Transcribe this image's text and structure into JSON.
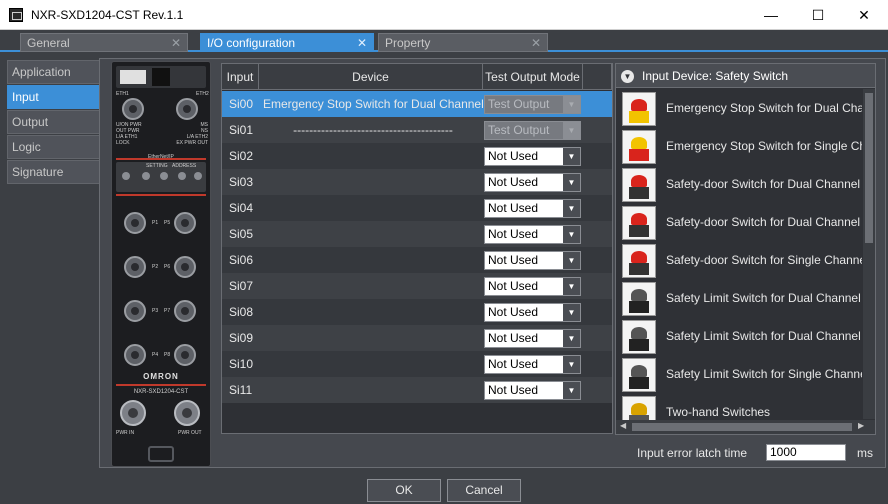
{
  "window": {
    "title": "NXR-SXD1204-CST Rev.1.1",
    "minimize_glyph": "—",
    "maximize_glyph": "☐",
    "close_glyph": "✕"
  },
  "tabs": [
    {
      "label": "General",
      "close": "✕"
    },
    {
      "label": "I/O configuration",
      "close": "✕"
    },
    {
      "label": "Property",
      "close": "✕"
    }
  ],
  "sidetabs": [
    "Application",
    "Input",
    "Output",
    "Logic",
    "Signature"
  ],
  "table": {
    "headers": [
      "Input",
      "Device",
      "Test Output Mode"
    ],
    "rows": [
      {
        "input": "Si00",
        "device": "Emergency Stop Switch for Dual Channel",
        "mode": "Test Output"
      },
      {
        "input": "Si01",
        "device": "----------------------------------------",
        "mode": "Test Output"
      },
      {
        "input": "Si02",
        "device": "",
        "mode": "Not Used"
      },
      {
        "input": "Si03",
        "device": "",
        "mode": "Not Used"
      },
      {
        "input": "Si04",
        "device": "",
        "mode": "Not Used"
      },
      {
        "input": "Si05",
        "device": "",
        "mode": "Not Used"
      },
      {
        "input": "Si06",
        "device": "",
        "mode": "Not Used"
      },
      {
        "input": "Si07",
        "device": "",
        "mode": "Not Used"
      },
      {
        "input": "Si08",
        "device": "",
        "mode": "Not Used"
      },
      {
        "input": "Si09",
        "device": "",
        "mode": "Not Used"
      },
      {
        "input": "Si10",
        "device": "",
        "mode": "Not Used"
      },
      {
        "input": "Si11",
        "device": "",
        "mode": "Not Used"
      }
    ]
  },
  "device_list": {
    "header": "Input Device: Safety Switch",
    "header_icon": "▼",
    "items": [
      {
        "label": "Emergency Stop Switch for Dual Channel",
        "icon": "estop-red-icon"
      },
      {
        "label": "Emergency Stop Switch for Single Channel",
        "icon": "estop-yellow-icon"
      },
      {
        "label": "Safety-door Switch for Dual Channel",
        "icon": "door-switch-icon"
      },
      {
        "label": "Safety-door Switch for Dual Channel",
        "icon": "door-switch-icon"
      },
      {
        "label": "Safety-door Switch for Single Channel",
        "icon": "door-switch-icon"
      },
      {
        "label": "Safety Limit Switch for Dual Channel",
        "icon": "limit-switch-icon"
      },
      {
        "label": "Safety Limit Switch for Dual Channel",
        "icon": "limit-switch-icon"
      },
      {
        "label": "Safety Limit Switch for Single Channel",
        "icon": "limit-switch-icon"
      },
      {
        "label": "Two-hand Switches",
        "icon": "two-hand-switch-icon"
      }
    ]
  },
  "module": {
    "eth1": "ETH1",
    "eth2": "ETH2",
    "status_left": [
      "U/ON PWR",
      "OUT PWR",
      "L/A ETH1",
      "LOCK"
    ],
    "status_right": [
      "MS",
      "NS",
      "L/A ETH2",
      "EX PWR OUT"
    ],
    "ethernet_ip": "EtherNet/IP",
    "setting": "SETTING",
    "address": "ADDRESS",
    "brand": "OMRON",
    "model": "NXR-SXD1204-CST",
    "pwr_in": "PWR IN",
    "pwr_out": "PWR OUT",
    "port_labels": [
      "P1",
      "P5",
      "P2",
      "P6",
      "P3",
      "P7",
      "P4",
      "P8"
    ]
  },
  "latch": {
    "label": "Input error latch time",
    "value": "1000",
    "unit": "ms"
  },
  "buttons": {
    "ok": "OK",
    "cancel": "Cancel"
  },
  "colors": {
    "accent": "#3c8fd7",
    "background": "#3c3f44"
  }
}
